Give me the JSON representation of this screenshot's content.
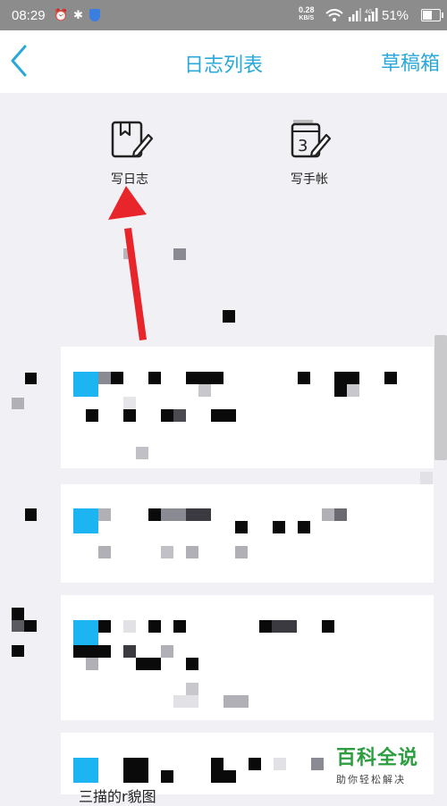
{
  "status_bar": {
    "time": "08:29",
    "net_speed_value": "0.28",
    "net_speed_unit": "KB/S",
    "battery": "51%"
  },
  "nav": {
    "title": "日志列表",
    "right_button": "草稿箱"
  },
  "actions": [
    {
      "label": "写日志",
      "icon": "diary-pen-icon"
    },
    {
      "label": "写手帐",
      "icon": "calendar-pen-icon"
    }
  ],
  "watermark": {
    "title": "百科全说",
    "subtitle": "助你轻松解决"
  },
  "bottom_text": "三描的r貌图",
  "colors": {
    "accent": "#2aa8d8",
    "status_bar": "#8c8c8c",
    "arrow": "#e8252a",
    "tag": "#1cb5f2",
    "watermark": "#2c9e3f"
  }
}
